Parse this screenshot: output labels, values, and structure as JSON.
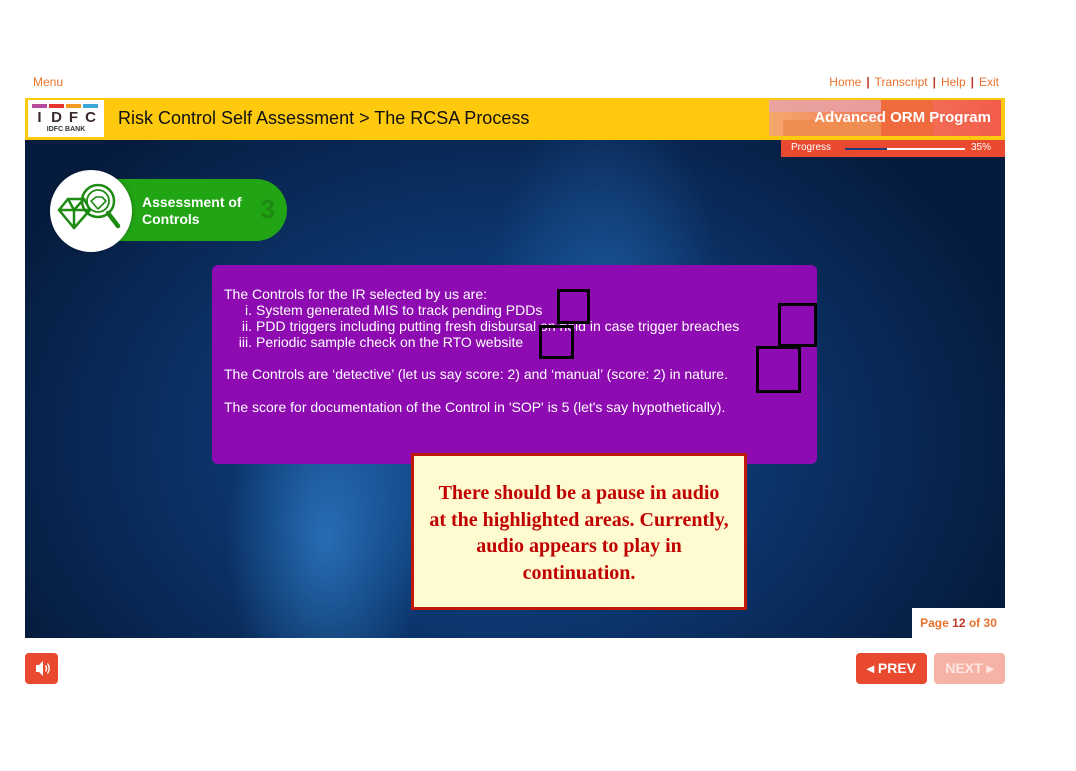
{
  "topbar": {
    "menu": "Menu",
    "links": [
      "Home",
      "Transcript",
      "Help",
      "Exit"
    ]
  },
  "header": {
    "logo_letters": [
      "I",
      "D",
      "F",
      "C"
    ],
    "logo_letter_colors": [
      "#b84a9c",
      "#e7352c",
      "#f39a20",
      "#3aa6d9"
    ],
    "logo_subtext": "IDFC BANK",
    "title": "Risk Control Self Assessment > The RCSA Process",
    "program": "Advanced ORM Program"
  },
  "progress": {
    "label": "Progress",
    "value": 0.35,
    "percent_text": "35%"
  },
  "section": {
    "label_line1": "Assessment of",
    "label_line2": "Controls",
    "number": "3",
    "icon": "diamond-magnifier-icon"
  },
  "content": {
    "intro": "The Controls for the IR selected by us are:",
    "items": [
      {
        "marker": "i.",
        "text": "System generated MIS to track pending PDDs"
      },
      {
        "marker": "ii.",
        "text": "PDD triggers including putting fresh disbursal on hold in case trigger breaches"
      },
      {
        "marker": "iii.",
        "text": "Periodic sample check on the RTO website"
      }
    ],
    "para2": "The Controls are ‘detective’ (let us say score: 2) and ‘manual’ (score: 2) in nature.",
    "para3": "The score for documentation of the Control in 'SOP' is 5 (let's say hypothetically)."
  },
  "annotation": {
    "note": "There should be a pause in audio at the highlighted areas. Currently, audio appears to play in continuation."
  },
  "page": {
    "prefix": "Page",
    "current": "12",
    "separator": "of",
    "total": "30"
  },
  "controls": {
    "audio_icon": "speaker-icon",
    "prev": "PREV",
    "next": "NEXT"
  },
  "colors": {
    "accent": "#e8492f",
    "header_yellow": "#ffc90e",
    "panel_purple": "#8e0ab1",
    "section_green": "#22a514",
    "note_red": "#c00000"
  }
}
